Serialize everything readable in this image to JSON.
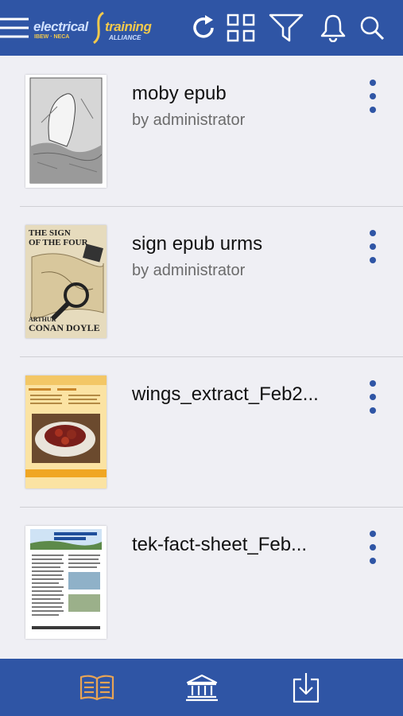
{
  "header": {
    "logo": {
      "word1": "electrical",
      "word2": "training",
      "sub1": "IBEW · NECA",
      "sub2": "ALLIANCE"
    },
    "icons": [
      "menu-icon",
      "refresh-icon",
      "grid-icon",
      "filter-icon",
      "bell-icon",
      "search-icon"
    ]
  },
  "items": [
    {
      "title": "moby epub",
      "author": "by administrator",
      "thumb": "moby-cover"
    },
    {
      "title": "sign epub urms",
      "author": "by administrator",
      "thumb": "sign-of-four-cover",
      "cover_text": {
        "line1": "THE SIGN",
        "line2": "OF THE FOUR",
        "author1": "ARTHUR",
        "author2": "CONAN DOYLE"
      }
    },
    {
      "title": "wings_extract_Feb2...",
      "author": "",
      "thumb": "wings-cover"
    },
    {
      "title": "tek-fact-sheet_Feb...",
      "author": "",
      "thumb": "tek-cover"
    }
  ],
  "footer": {
    "tabs": [
      "book-icon",
      "library-icon",
      "download-icon"
    ],
    "active": "book-icon"
  },
  "colors": {
    "primary": "#2f55a5",
    "active_tab": "#e8a455",
    "background": "#efeff4"
  }
}
